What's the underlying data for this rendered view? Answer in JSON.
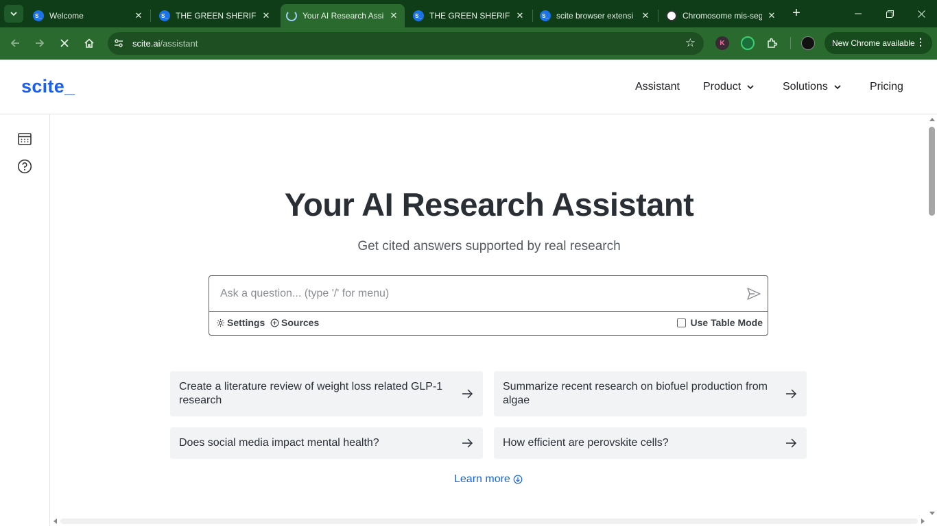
{
  "browser": {
    "tabs": [
      {
        "title": "Welcome",
        "favicon": "scite-icon",
        "active": false
      },
      {
        "title": "THE GREEN SHERIFFS",
        "favicon": "scite-icon",
        "active": false
      },
      {
        "title": "Your AI Research Assi",
        "favicon": "loading-icon",
        "active": true
      },
      {
        "title": "THE GREEN SHERIFFS",
        "favicon": "scite-icon",
        "active": false
      },
      {
        "title": "scite browser extensi",
        "favicon": "scite-icon",
        "active": false
      },
      {
        "title": "Chromosome mis-seg",
        "favicon": "globe-icon",
        "active": false
      }
    ],
    "close_glyph": "✕",
    "new_tab_glyph": "+",
    "url_host": "scite.ai",
    "url_path": "/assistant",
    "new_chrome_label": "New Chrome available",
    "extension_k_label": "K",
    "colors": {
      "frame": "#0f3d17",
      "toolbar": "#2b6a2e",
      "omnibox": "#1d4f22"
    }
  },
  "site": {
    "logo": "scite_",
    "nav": [
      {
        "label": "Assistant",
        "has_dropdown": false
      },
      {
        "label": "Product",
        "has_dropdown": true
      },
      {
        "label": "Solutions",
        "has_dropdown": true
      },
      {
        "label": "Pricing",
        "has_dropdown": false
      }
    ],
    "brand_color": "#1b5ef0"
  },
  "rail": {
    "icons": [
      "calendar-icon",
      "help-icon"
    ]
  },
  "main": {
    "title": "Your AI Research Assistant",
    "subtitle": "Get cited answers supported by real research",
    "ask": {
      "placeholder": "Ask a question... (type '/' for menu)",
      "value": "",
      "settings_label": "Settings",
      "sources_label": "Sources",
      "table_mode_label": "Use Table Mode",
      "table_mode_checked": false
    },
    "suggestions": [
      "Create a literature review of weight loss related GLP-1 research",
      "Summarize recent research on biofuel production from algae",
      "Does social media impact mental health?",
      "How efficient are perovskite cells?"
    ],
    "learn_more": "Learn more",
    "link_color": "#1565e6"
  }
}
